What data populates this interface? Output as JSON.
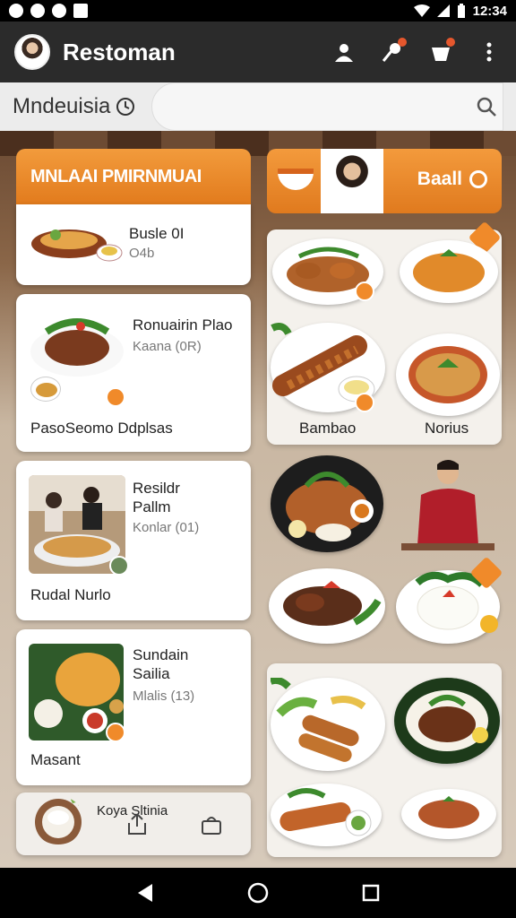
{
  "status_bar": {
    "time": "12:34"
  },
  "app_bar": {
    "title": "Restoman"
  },
  "search": {
    "location": "Mndeuisia"
  },
  "left_section": {
    "header": "MNLAAI PMIRNMUAI",
    "cards": [
      {
        "name": "Busle 0I",
        "meta": "O4b"
      },
      {
        "name": "Ronuairin Plao",
        "meta": "Kaana (0R)",
        "footer": "PasoSeomo Ddplsas"
      },
      {
        "name": "Resildr\nPallm",
        "meta": "Konlar (01)",
        "footer": "Rudal Nurlo"
      },
      {
        "name": "Sundain\nSailia",
        "meta": "Mlalis (13)",
        "footer": "Masant"
      },
      {
        "name": "Koya Sltinia"
      }
    ]
  },
  "right_section": {
    "banner": "Baall",
    "grid1_labels": [
      "Bambao",
      "Norius"
    ]
  },
  "colors": {
    "accent": "#E8831F",
    "appbar": "#2B2B2B",
    "badge": "#F08A2A"
  }
}
